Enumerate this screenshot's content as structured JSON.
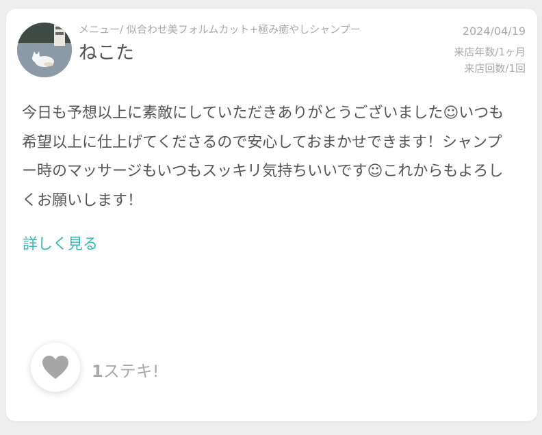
{
  "review": {
    "menu": "メニュー/ 似合わせ美フォルムカット+極み癒やしシャンプー",
    "reviewer_name": "ねこた",
    "avatar_icon": "cat-photo-avatar",
    "date": "2024/04/19",
    "visit_years": "来店年数/1ヶ月",
    "visit_count": "来店回数/1回",
    "body": "今日も予想以上に素敵にしていただきありがとうございました☺いつも希望以上に仕上げてくださるので安心しておまかせできます！シャンプー時のマッサージもいつもスッキリ気持ちいいです☺これからもよろしくお願いします！",
    "read_more": "詳しく見る"
  },
  "like": {
    "icon": "heart-icon",
    "count": "1",
    "label": "ステキ!"
  },
  "colors": {
    "accent": "#3bb7b3",
    "muted_text": "#a9a9a9",
    "body_text": "#555555",
    "heart": "#a6a6a6",
    "page_background": "#eeeeee"
  }
}
